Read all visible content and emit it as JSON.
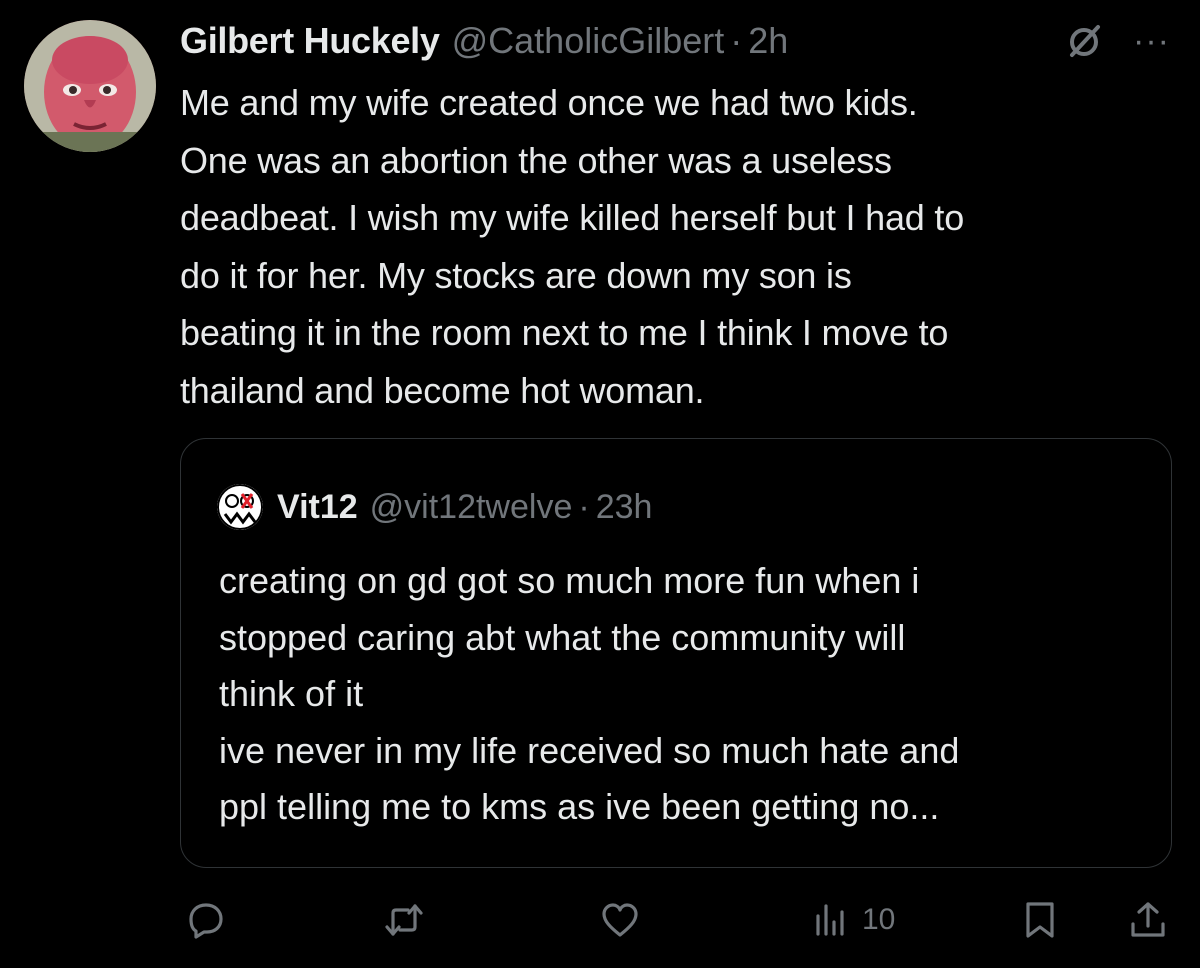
{
  "post": {
    "author": {
      "display_name": "Gilbert Huckely",
      "handle": "@CatholicGilbert",
      "separator": "·",
      "time": "2h"
    },
    "text_lines": [
      "Me and my wife created once we had two kids.",
      "One was an abortion the other was a useless",
      "deadbeat. I wish my wife killed herself but I had to",
      "do it for her. My stocks are down my son is",
      "beating it in the room next to me I think I move to",
      "thailand and become hot woman."
    ],
    "header_icons": [
      "grok-icon",
      "more-icon"
    ],
    "more_glyph": "···"
  },
  "quote": {
    "display_name": "Vit12",
    "handle": "@vit12twelve",
    "separator": "·",
    "time": "23h",
    "text_lines": [
      "creating on gd got so much more fun when i",
      "stopped caring abt what the community will",
      "think of it",
      "ive never in my life received so much hate and",
      "ppl telling me to kms as ive been getting no..."
    ]
  },
  "actions": {
    "icons": [
      "reply-icon",
      "repost-icon",
      "like-icon",
      "views-icon",
      "bookmark-icon",
      "share-icon"
    ],
    "views_count": "10"
  },
  "colors": {
    "background": "#000000",
    "primary_text": "#e7e9ea",
    "secondary_text": "#71767b",
    "border": "#2f3336"
  }
}
